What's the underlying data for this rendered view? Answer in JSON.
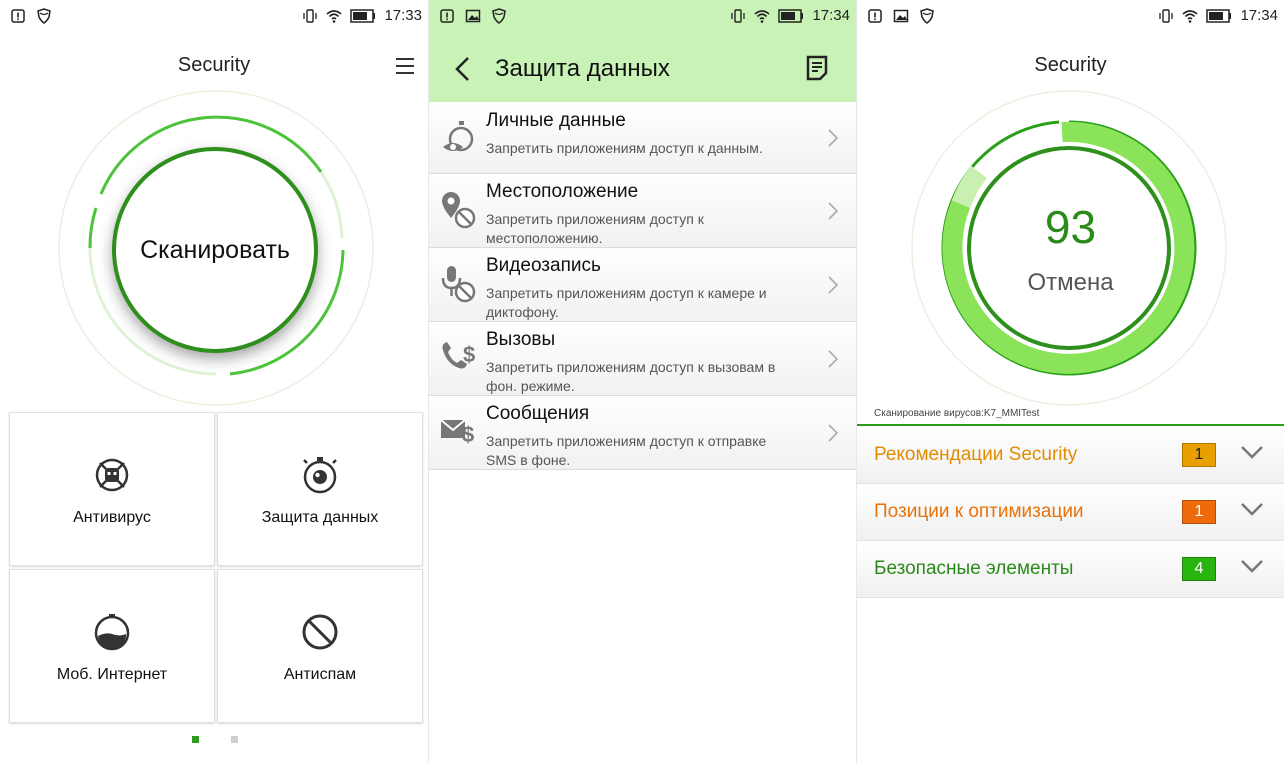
{
  "colors": {
    "green_dark": "#2f8f1d",
    "green_light": "#7be04a",
    "header_green": "#c9f2b6",
    "orange": "#e8a000",
    "orange_red": "#ee6a0b",
    "badge_green": "#28b50f"
  },
  "panel1": {
    "status": {
      "time": "17:33"
    },
    "title": "Security",
    "scan_button": "Сканировать",
    "tiles": [
      {
        "label": "Антивирус",
        "icon": "bug-icon"
      },
      {
        "label": "Защита данных",
        "icon": "stopwatch-eye-icon"
      },
      {
        "label": "Моб. Интернет",
        "icon": "gauge-icon"
      },
      {
        "label": "Антиспам",
        "icon": "block-icon"
      }
    ],
    "page_indicator": {
      "current": 1,
      "total": 2
    }
  },
  "panel2": {
    "status": {
      "time": "17:34"
    },
    "title": "Защита данных",
    "items": [
      {
        "title": "Личные данные",
        "desc": "Запретить приложениям доступ к данным.",
        "icon": "personal-data-icon"
      },
      {
        "title": "Местоположение",
        "desc": "Запретить приложениям доступ к местоположению.",
        "icon": "location-icon"
      },
      {
        "title": "Видеозапись",
        "desc": "Запретить приложениям доступ к камере и диктофону.",
        "icon": "microphone-icon"
      },
      {
        "title": "Вызовы",
        "desc": "Запретить приложениям доступ к вызовам в фон. режиме.",
        "icon": "call-icon"
      },
      {
        "title": "Сообщения",
        "desc": "Запретить приложениям доступ к отправке SMS в фоне.",
        "icon": "sms-icon"
      }
    ]
  },
  "panel3": {
    "status": {
      "time": "17:34"
    },
    "title": "Security",
    "score": "93",
    "cancel": "Отмена",
    "scan_label": "Сканирование вирусов:K7_MMITest",
    "categories": [
      {
        "label": "Рекомендации Security",
        "count": "1",
        "color": "#e8a000",
        "text_color": "#e08d00"
      },
      {
        "label": "Позиции к оптимизации",
        "count": "1",
        "color": "#ee6a0b",
        "text_color": "#e8730b"
      },
      {
        "label": "Безопасные элементы",
        "count": "4",
        "color": "#28b50f",
        "text_color": "#2a8a1a"
      }
    ]
  }
}
